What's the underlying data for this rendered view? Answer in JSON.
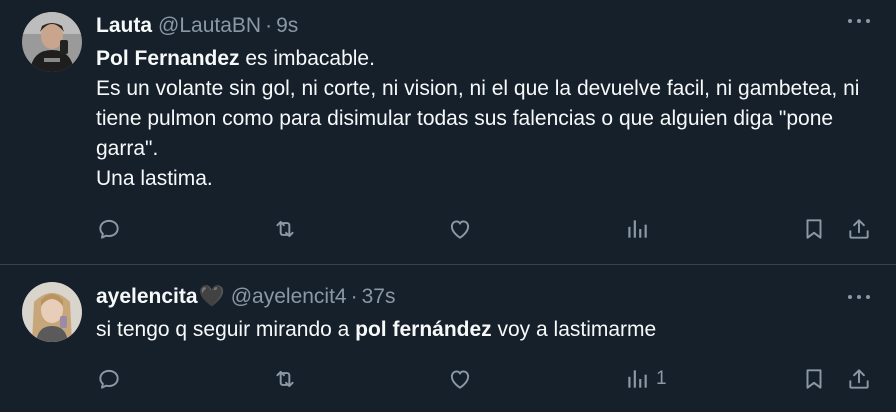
{
  "tweets": [
    {
      "name": "Lauta",
      "handle": "@LautaBN",
      "separator": "·",
      "time": "9s",
      "body_bold": "Pol Fernandez",
      "body_rest": " es imbacable.\nEs un volante sin gol, ni corte, ni vision, ni el que la devuelve facil, ni gambetea, ni tiene pulmon como para disimular todas sus falencias o que alguien diga \"pone garra\".\nUna lastima.",
      "views": ""
    },
    {
      "name": "ayelencita",
      "name_emoji": "🖤",
      "handle": "@ayelencit4",
      "separator": "·",
      "time": "37s",
      "body_pre": "si tengo q seguir mirando a ",
      "body_bold": "pol fernández",
      "body_post": " voy a lastimarme",
      "views": "1"
    }
  ],
  "colors": {
    "background": "#15202b",
    "text": "#f7f9f9",
    "secondary": "#8b98a5",
    "divider": "#38444d"
  }
}
